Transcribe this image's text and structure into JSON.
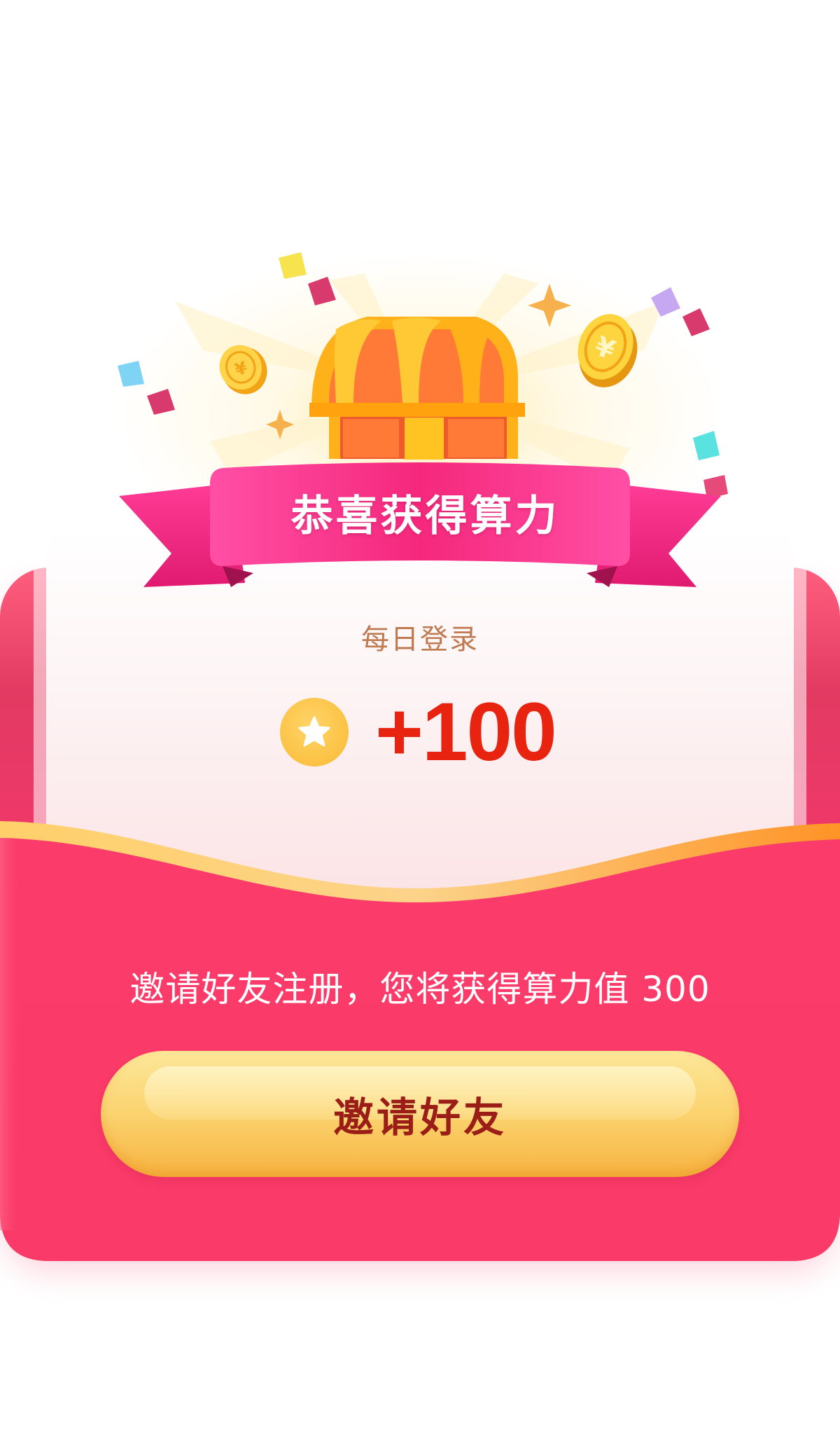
{
  "banner": {
    "title": "恭喜获得算力"
  },
  "reward": {
    "source_label": "每日登录",
    "amount": "+100",
    "icon": "star-coin-icon"
  },
  "invite": {
    "description": "邀请好友注册，您将获得算力值 300",
    "button_label": "邀请好友"
  },
  "decorations": {
    "chest_icon": "treasure-chest-icon",
    "coin_icon": "yuan-coin-icon",
    "sparkle_icon": "sparkle-icon",
    "confetti_icon": "confetti-icon"
  },
  "colors": {
    "card_red": "#fb3c6a",
    "amount_red": "#e8230f",
    "button_gold": "#fbd36f",
    "button_text": "#9a1d18",
    "label_brown": "#c07a52",
    "ribbon_pink": "#f42d86"
  }
}
